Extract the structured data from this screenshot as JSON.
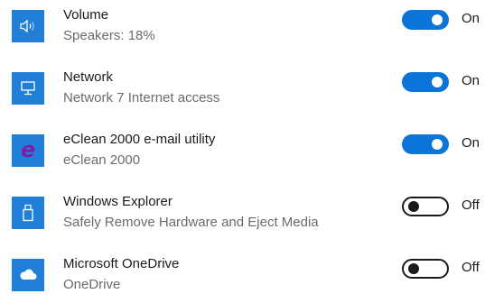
{
  "items": [
    {
      "title": "Volume",
      "subtitle": "Speakers: 18%",
      "icon": "speaker-icon",
      "state_label": "On",
      "enabled": true
    },
    {
      "title": "Network",
      "subtitle": "Network  7 Internet access",
      "icon": "network-icon",
      "state_label": "On",
      "enabled": true
    },
    {
      "title": "eClean 2000 e-mail utility",
      "subtitle": "eClean 2000",
      "icon": "eclean-logo-icon",
      "icon_glyph": "e",
      "state_label": "On",
      "enabled": true
    },
    {
      "title": "Windows Explorer",
      "subtitle": "Safely Remove Hardware and Eject Media",
      "icon": "usb-drive-icon",
      "state_label": "Off",
      "enabled": false
    },
    {
      "title": "Microsoft OneDrive",
      "subtitle": "OneDrive",
      "icon": "cloud-icon",
      "state_label": "Off",
      "enabled": false
    }
  ],
  "colors": {
    "icon_tile": "#1f7fd9",
    "toggle_on": "#0a74d8",
    "toggle_off_border": "#1a1a1a",
    "eclean_glyph": "#7b1fa2"
  }
}
